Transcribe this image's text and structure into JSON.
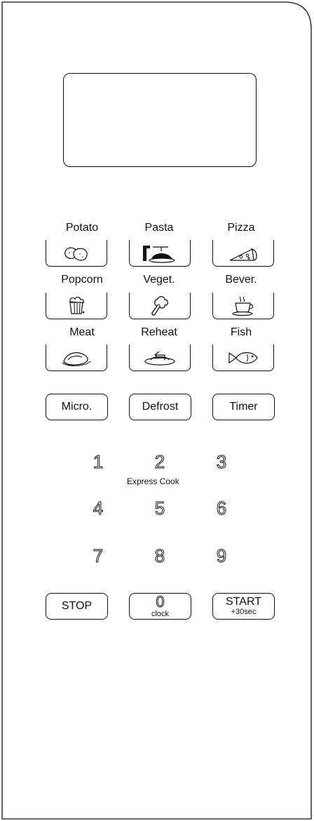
{
  "presets": [
    {
      "label": "Potato",
      "icon": "potato-icon"
    },
    {
      "label": "Pasta",
      "icon": "pasta-icon"
    },
    {
      "label": "Pizza",
      "icon": "pizza-icon"
    },
    {
      "label": "Popcorn",
      "icon": "popcorn-icon"
    },
    {
      "label": "Veget.",
      "icon": "vegetable-icon"
    },
    {
      "label": "Bever.",
      "icon": "beverage-icon"
    },
    {
      "label": "Meat",
      "icon": "meat-icon"
    },
    {
      "label": "Reheat",
      "icon": "reheat-icon"
    },
    {
      "label": "Fish",
      "icon": "fish-icon"
    }
  ],
  "modes": {
    "micro": "Micro.",
    "defrost": "Defrost",
    "timer": "Timer"
  },
  "keypad": {
    "digits": [
      "1",
      "2",
      "3",
      "4",
      "5",
      "6",
      "7",
      "8",
      "9"
    ],
    "express_note": "Express Cook"
  },
  "bottom": {
    "stop": "STOP",
    "zero": "0",
    "zero_sub": "clock",
    "start": "START",
    "start_sub": "+30sec"
  }
}
